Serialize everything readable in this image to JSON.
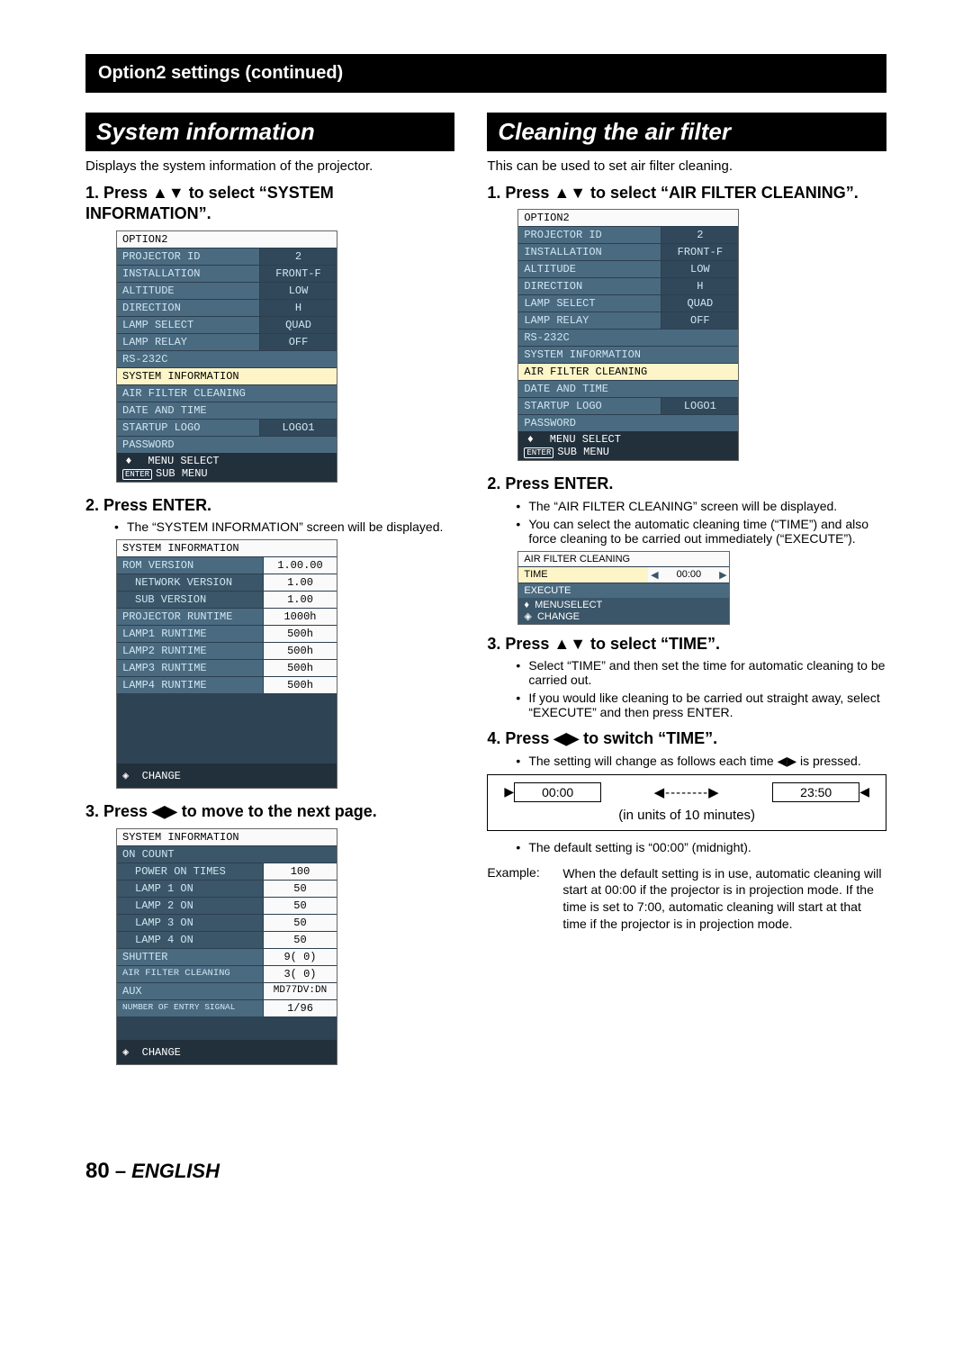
{
  "topbar": "Option2 settings (continued)",
  "left": {
    "title": "System information",
    "intro": "Displays the system information of the projector.",
    "step1_h": "1.  Press ▲▼ to select “SYSTEM INFORMATION”.",
    "step2_h": "2.  Press ENTER.",
    "step2_b1": "The “SYSTEM INFORMATION”  screen will be displayed.",
    "step3_h": "3.  Press ◀▶ to move to the next page."
  },
  "right": {
    "title": "Cleaning the air filter",
    "intro": "This can be used to set air filter cleaning.",
    "step1_h": "1.  Press ▲▼ to select “AIR FILTER CLEANING”.",
    "step2_h": "2.  Press ENTER.",
    "step2_b1": "The “AIR FILTER CLEANING” screen will be displayed.",
    "step2_b2": "You can select the automatic cleaning time (“TIME”) and also force cleaning to be carried out immediately (“EXECUTE”).",
    "step3_h": "3.  Press ▲▼ to select “TIME”.",
    "step3_b1": "Select “TIME” and then set the time for automatic cleaning to be carried out.",
    "step3_b2": "If you would like cleaning to be carried out straight away, select “EXECUTE” and then press ENTER.",
    "step4_h": "4.  Press ◀▶ to switch “TIME”.",
    "step4_b1": "The setting will change as follows each time ◀▶ is pressed.",
    "step4_b2": "The default setting is “00:00” (midnight).",
    "example_label": "Example:",
    "example_text": "When the default setting is in use, automatic cleaning will start at 00:00 if the projector is in projection mode. If the time is set to 7:00, automatic cleaning will start at that time if the projector is in projection mode."
  },
  "menu_option2": {
    "title": "OPTION2",
    "rows": [
      {
        "l": "PROJECTOR ID",
        "r": "2"
      },
      {
        "l": "INSTALLATION",
        "r": "FRONT-F"
      },
      {
        "l": "ALTITUDE",
        "r": "LOW"
      },
      {
        "l": "DIRECTION",
        "r": "H"
      },
      {
        "l": "LAMP SELECT",
        "r": "QUAD"
      },
      {
        "l": "LAMP RELAY",
        "r": "OFF"
      }
    ],
    "rs232c": "RS-232C",
    "sysinfo": "SYSTEM INFORMATION",
    "airfilter": "AIR FILTER CLEANING",
    "dat": "DATE AND TIME",
    "startup_l": "STARTUP LOGO",
    "startup_r": "LOGO1",
    "password": "PASSWORD",
    "ft1": "MENU SELECT",
    "ft2": "SUB MENU",
    "enter": "ENTER",
    "updown": "◆"
  },
  "sysinfo1": {
    "title": "SYSTEM INFORMATION",
    "rows": [
      {
        "l": "ROM VERSION",
        "r": "1.00.00",
        "sub": false
      },
      {
        "l": "NETWORK VERSION",
        "r": "1.00",
        "sub": true
      },
      {
        "l": "SUB VERSION",
        "r": "1.00",
        "sub": true
      },
      {
        "l": "PROJECTOR RUNTIME",
        "r": "1000h",
        "sub": false
      },
      {
        "l": "LAMP1 RUNTIME",
        "r": "500h",
        "sub": false
      },
      {
        "l": "LAMP2 RUNTIME",
        "r": "500h",
        "sub": false
      },
      {
        "l": "LAMP3 RUNTIME",
        "r": "500h",
        "sub": false
      },
      {
        "l": "LAMP4 RUNTIME",
        "r": "500h",
        "sub": false
      }
    ],
    "ft": "CHANGE"
  },
  "sysinfo2": {
    "title": "SYSTEM INFORMATION",
    "oncount": "ON COUNT",
    "rows": [
      {
        "l": "POWER ON TIMES",
        "r": "100"
      },
      {
        "l": "LAMP 1 ON",
        "r": "50"
      },
      {
        "l": "LAMP 2 ON",
        "r": "50"
      },
      {
        "l": "LAMP 3 ON",
        "r": "50"
      },
      {
        "l": "LAMP 4 ON",
        "r": "50"
      }
    ],
    "shutter_l": "SHUTTER",
    "shutter_r": "9(   0)",
    "afc_l": "AIR FILTER CLEANING",
    "afc_r": "3(   0)",
    "aux_l": "AUX",
    "aux_r": "MD77DV:DN",
    "entry_l": "NUMBER OF ENTRY SIGNAL",
    "entry_r": "1/96",
    "ft": "CHANGE"
  },
  "afc_menu": {
    "title": "AIR FILTER CLEANING",
    "time_l": "TIME",
    "time_r": "00:00",
    "execute": "EXECUTE",
    "ft1": "MENUSELECT",
    "ft2": "CHANGE"
  },
  "cycle": {
    "a": "00:00",
    "b": "23:50",
    "mid": "◀--------▶",
    "cap": "(in units of 10 minutes)"
  },
  "footer": {
    "page": "80",
    "sep": " – ",
    "lang": "ENGLISH"
  }
}
